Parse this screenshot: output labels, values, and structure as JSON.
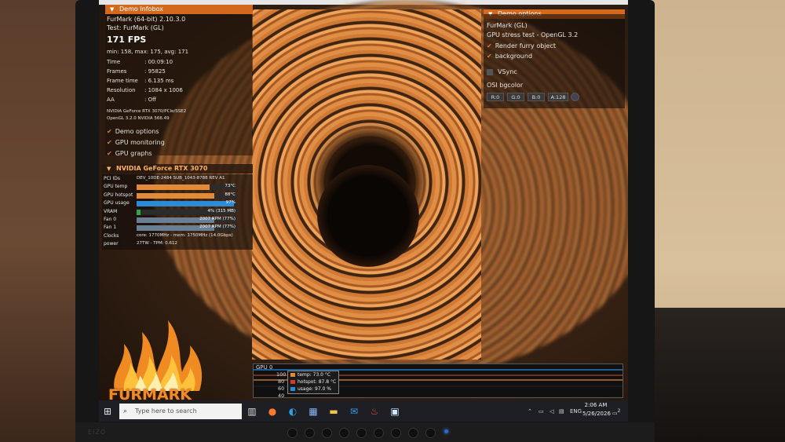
{
  "demo_info": {
    "panel_title": "Demo Infobox",
    "app_version": "FurMark (64-bit) 2.10.3.0",
    "test": "Test: FurMark (GL)",
    "fps": "171 FPS",
    "fps_stats": "min: 158, max: 175, avg: 171",
    "time_label": "Time",
    "time_value": ": 00:09:10",
    "frames_label": "Frames",
    "frames_value": ": 95825",
    "frametime_label": "Frame time",
    "frametime_value": ": 6.135 ms",
    "resolution_label": "Resolution",
    "resolution_value": ": 1084 x 1006",
    "aa_label": "AA",
    "aa_value": ": Off",
    "renderer": "NVIDIA GeForce RTX 3070/PCIe/SSE2",
    "opengl": "OpenGL 3.2.0 NVIDIA 566.49",
    "options": [
      "Demo options",
      "GPU monitoring",
      "GPU graphs"
    ]
  },
  "demo_options": {
    "panel_title": "Demo options",
    "name": "FurMark (GL)",
    "subtitle": "GPU stress test - OpenGL 3.2",
    "render_furry": "Render furry object",
    "background": "background",
    "vsync": "VSync",
    "osi_label": "OSI bgcolor",
    "swatches": [
      "R:0",
      "G:0",
      "B:0",
      "A:128"
    ]
  },
  "gpu": {
    "title": "NVIDIA GeForce RTX 3070",
    "rows": [
      {
        "label": "PCI IDs",
        "value": "DEV_10DE-2484 SUB_1043-8788 REV A1"
      },
      {
        "label": "GPU temp",
        "value": "73°C",
        "pct": 0.73,
        "color": "#e08a3a"
      },
      {
        "label": "GPU hotspot",
        "value": "88°C",
        "pct": 0.77,
        "color": "#e08a3a"
      },
      {
        "label": "GPU usage",
        "value": "97%",
        "pct": 0.97,
        "color": "#2b8bd6"
      },
      {
        "label": "VRAM",
        "value": "4% (315 MB)",
        "pct": 0.04,
        "color": "#2aa84a"
      },
      {
        "label": "Fan 0",
        "value": "2007 RPM (77%)",
        "pct": 0.77,
        "color": "#6a7f94"
      },
      {
        "label": "Fan 1",
        "value": "2007 RPM (77%)",
        "pct": 0.77,
        "color": "#6a7f94"
      },
      {
        "label": "Clocks",
        "value": "core: 1770MHz - mem: 1750MHz (14.0Gbps)"
      },
      {
        "label": "power",
        "value": "27TW - TPM: 0.612"
      }
    ]
  },
  "logo": {
    "text": "FURMARK"
  },
  "graph": {
    "title": "GPU 0",
    "axis": [
      "100",
      "80",
      "60",
      "40"
    ],
    "legend": [
      {
        "label": "temp: 73.0 °C",
        "color": "#e08a3a"
      },
      {
        "label": "hotspot: 87.8 °C",
        "color": "#d83a2a"
      },
      {
        "label": "usage: 97.0 %",
        "color": "#2b8bd6"
      }
    ]
  },
  "taskbar": {
    "search_placeholder": "Type here to search",
    "lang": "ENG",
    "time": "2:06 AM",
    "date": "5/26/2026",
    "notif_count": "2"
  },
  "monitor": {
    "brand": "EIZO"
  }
}
